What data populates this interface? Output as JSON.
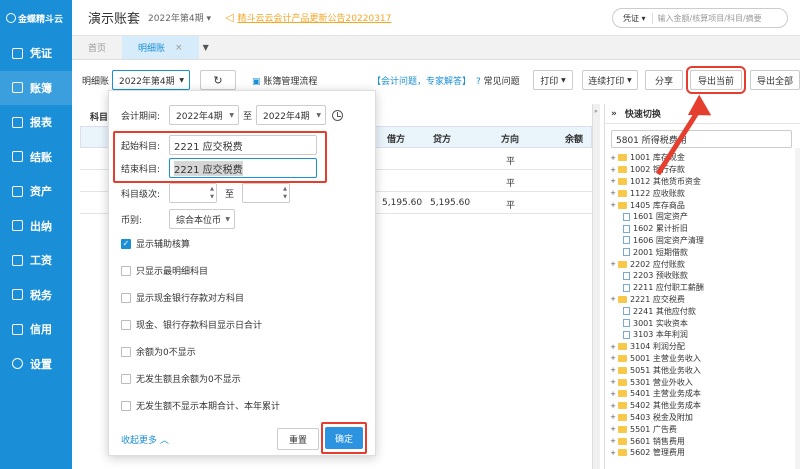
{
  "sidebar": {
    "logo_text": "金蝶精斗云",
    "items": [
      {
        "label": "凭证",
        "icon": "voucher-icon"
      },
      {
        "label": "账簿",
        "icon": "ledger-icon"
      },
      {
        "label": "报表",
        "icon": "report-icon"
      },
      {
        "label": "结账",
        "icon": "closing-icon"
      },
      {
        "label": "资产",
        "icon": "asset-icon"
      },
      {
        "label": "出纳",
        "icon": "cashier-icon"
      },
      {
        "label": "工资",
        "icon": "salary-icon"
      },
      {
        "label": "税务",
        "icon": "tax-icon"
      },
      {
        "label": "信用",
        "icon": "credit-icon"
      },
      {
        "label": "设置",
        "icon": "gear-icon"
      }
    ]
  },
  "header": {
    "title": "演示账套",
    "period": "2022年第4期",
    "notice": "精斗云云会计产品更新公告20220317",
    "search_type": "凭证",
    "search_placeholder": "输入金额/核算项目/科目/摘要"
  },
  "tabs": [
    {
      "label": "首页"
    },
    {
      "label": "明细账",
      "close": "×"
    }
  ],
  "toolbar": {
    "label": "明细账",
    "period_value": "2022年第4期",
    "flow_link": "账簿管理流程",
    "help_link": "【会计问题，专家解答】",
    "faq": "常见问题",
    "print": "打印",
    "batch_print": "连续打印",
    "share": "分享",
    "export_current": "导出当前",
    "export_all": "导出全部"
  },
  "table": {
    "subject_label": "科目:",
    "columns": {
      "debit": "借方",
      "credit": "贷方",
      "direction": "方向",
      "balance": "余额"
    },
    "rows": [
      {
        "debit": "",
        "credit": "",
        "direction": "平"
      },
      {
        "debit": "",
        "credit": "",
        "direction": "平"
      },
      {
        "debit": "5,195.60",
        "credit": "5,195.60",
        "direction": "平"
      }
    ]
  },
  "filter": {
    "period_label": "会计期间:",
    "period_from": "2022年4期",
    "to_label": "至",
    "period_to": "2022年4期",
    "start_label": "起始科目:",
    "start_value": "2221 应交税费",
    "end_label": "结束科目:",
    "end_value": "2221 应交税费",
    "level_label": "科目级次:",
    "level_to": "至",
    "currency_label": "币别:",
    "currency_value": "综合本位币",
    "options": [
      {
        "label": "显示辅助核算",
        "checked": true
      },
      {
        "label": "只显示最明细科目",
        "checked": false
      },
      {
        "label": "显示现金银行存款对方科目",
        "checked": false
      },
      {
        "label": "现金、银行存款科目显示日合计",
        "checked": false
      },
      {
        "label": "余额为0不显示",
        "checked": false
      },
      {
        "label": "无发生额且余额为0不显示",
        "checked": false
      },
      {
        "label": "无发生额不显示本期合计、本年累计",
        "checked": false
      }
    ],
    "collapse": "收起更多",
    "reset": "重置",
    "confirm": "确定"
  },
  "quick_switch": {
    "title": "快速切换",
    "search_value": "5801 所得税费用",
    "tree": [
      {
        "label": "1001 库存现金",
        "type": "folder",
        "pm": "+"
      },
      {
        "label": "1002 银行存款",
        "type": "folder",
        "pm": "+"
      },
      {
        "label": "1012 其他货币资金",
        "type": "folder",
        "pm": "+"
      },
      {
        "label": "1122 应收账款",
        "type": "folder",
        "pm": "+"
      },
      {
        "label": "1405 库存商品",
        "type": "folder",
        "pm": "+"
      },
      {
        "label": "1601 固定资产",
        "type": "file",
        "pm": ""
      },
      {
        "label": "1602 累计折旧",
        "type": "file",
        "pm": ""
      },
      {
        "label": "1606 固定资产清理",
        "type": "file",
        "pm": ""
      },
      {
        "label": "2001 短期借款",
        "type": "file",
        "pm": ""
      },
      {
        "label": "2202 应付账款",
        "type": "folder",
        "pm": "+"
      },
      {
        "label": "2203 预收账款",
        "type": "file",
        "pm": ""
      },
      {
        "label": "2211 应付职工薪酬",
        "type": "file",
        "pm": ""
      },
      {
        "label": "2221 应交税费",
        "type": "folder",
        "pm": "+"
      },
      {
        "label": "2241 其他应付款",
        "type": "file",
        "pm": ""
      },
      {
        "label": "3001 实收资本",
        "type": "file",
        "pm": ""
      },
      {
        "label": "3103 本年利润",
        "type": "file",
        "pm": ""
      },
      {
        "label": "3104 利润分配",
        "type": "folder",
        "pm": "+"
      },
      {
        "label": "5001 主营业务收入",
        "type": "folder",
        "pm": "+"
      },
      {
        "label": "5051 其他业务收入",
        "type": "folder",
        "pm": "+"
      },
      {
        "label": "5301 营业外收入",
        "type": "folder",
        "pm": "+"
      },
      {
        "label": "5401 主营业务成本",
        "type": "folder",
        "pm": "+"
      },
      {
        "label": "5402 其他业务成本",
        "type": "folder",
        "pm": "+"
      },
      {
        "label": "5403 税金及附加",
        "type": "folder",
        "pm": "+"
      },
      {
        "label": "5501 广告费",
        "type": "folder",
        "pm": "+"
      },
      {
        "label": "5601 销售费用",
        "type": "folder",
        "pm": "+"
      },
      {
        "label": "5602 管理费用",
        "type": "folder",
        "pm": "+"
      }
    ]
  },
  "colors": {
    "brand": "#1a8fd8",
    "highlight": "#e53e2f",
    "notice": "#f5a623"
  }
}
